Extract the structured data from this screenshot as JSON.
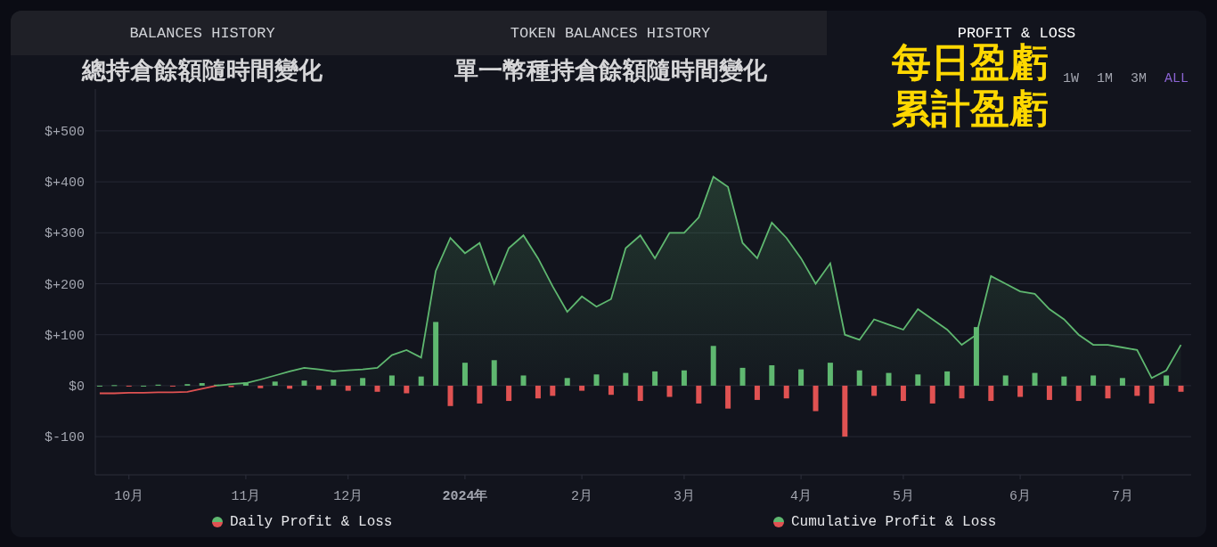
{
  "tabs": [
    {
      "label": "BALANCES HISTORY",
      "annotation": "總持倉餘額隨時間變化",
      "selected": false
    },
    {
      "label": "TOKEN BALANCES HISTORY",
      "annotation": "單一幣種持倉餘額隨時間變化",
      "selected": false
    },
    {
      "label": "PROFIT & LOSS",
      "annotation_lines": [
        "每日盈虧",
        "累計盈虧"
      ],
      "selected": true
    }
  ],
  "ranges": [
    {
      "label": "1W",
      "selected": false
    },
    {
      "label": "1M",
      "selected": false
    },
    {
      "label": "3M",
      "selected": false
    },
    {
      "label": "ALL",
      "selected": true
    }
  ],
  "chart_data": {
    "type": "bar",
    "categories": [
      null,
      null,
      "10月",
      null,
      null,
      null,
      null,
      null,
      null,
      null,
      "11月",
      null,
      null,
      null,
      null,
      null,
      null,
      "12月",
      null,
      null,
      null,
      null,
      null,
      null,
      null,
      "2024年",
      null,
      null,
      null,
      null,
      null,
      null,
      null,
      "2月",
      null,
      null,
      null,
      null,
      null,
      null,
      "3月",
      null,
      null,
      null,
      null,
      null,
      null,
      null,
      "4月",
      null,
      null,
      null,
      null,
      null,
      null,
      "5月",
      null,
      null,
      null,
      null,
      null,
      null,
      null,
      "6月",
      null,
      null,
      null,
      null,
      null,
      null,
      "7月",
      null,
      null,
      null,
      null
    ],
    "series": [
      {
        "color": "#5fb870",
        "values": [
          0,
          1,
          null,
          0,
          2,
          null,
          3,
          5,
          2,
          null,
          6,
          null,
          8,
          null,
          10,
          null,
          12,
          null,
          15,
          null,
          20,
          null,
          18,
          125,
          null,
          45,
          null,
          50,
          null,
          20,
          null,
          null,
          15,
          null,
          22,
          null,
          25,
          null,
          28,
          null,
          30,
          null,
          78,
          null,
          35,
          null,
          40,
          null,
          32,
          null,
          45,
          null,
          30,
          null,
          25,
          null,
          22,
          null,
          28,
          null,
          115,
          null,
          20,
          null,
          25,
          null,
          18,
          null,
          20,
          null,
          15,
          null,
          null,
          20,
          null
        ]
      },
      {
        "color": "#e05252",
        "values": [
          null,
          null,
          -1,
          null,
          null,
          -1,
          null,
          null,
          null,
          -3,
          null,
          -5,
          null,
          -6,
          null,
          -8,
          null,
          -10,
          null,
          -12,
          null,
          -15,
          null,
          null,
          -40,
          null,
          -35,
          null,
          -30,
          null,
          -25,
          -20,
          null,
          -10,
          null,
          -18,
          null,
          -30,
          null,
          -22,
          null,
          -35,
          null,
          -45,
          null,
          -28,
          null,
          -25,
          null,
          -50,
          null,
          -100,
          null,
          -20,
          null,
          -30,
          null,
          -35,
          null,
          -25,
          null,
          -30,
          null,
          -22,
          null,
          -28,
          null,
          -30,
          null,
          -25,
          null,
          -20,
          -35,
          null,
          -12
        ]
      },
      {
        "type": "area",
        "color": "#5fb870",
        "values": [
          null,
          null,
          null,
          null,
          null,
          null,
          null,
          null,
          0,
          3,
          5,
          12,
          20,
          28,
          35,
          32,
          28,
          30,
          32,
          35,
          60,
          70,
          55,
          225,
          290,
          260,
          280,
          200,
          270,
          295,
          250,
          195,
          145,
          175,
          155,
          170,
          270,
          295,
          250,
          300,
          300,
          330,
          410,
          390,
          280,
          250,
          320,
          290,
          250,
          200,
          240,
          100,
          90,
          130,
          120,
          110,
          150,
          130,
          110,
          80,
          100,
          215,
          200,
          185,
          180,
          150,
          130,
          100,
          80,
          80,
          75,
          70,
          15,
          30,
          80
        ]
      },
      {
        "type": "line",
        "color": "#e05252",
        "values": [
          -15,
          -15,
          -14,
          -14,
          -13,
          -13,
          -12,
          -6,
          0,
          null,
          null,
          null,
          null,
          null,
          null,
          null,
          null,
          null,
          null,
          null,
          null,
          null,
          null,
          null,
          null,
          null,
          null,
          null,
          null,
          null,
          null,
          null,
          null,
          null,
          null,
          null,
          null,
          null,
          null,
          null,
          null,
          null,
          null,
          null,
          null,
          null,
          null,
          null,
          null,
          null,
          null,
          null,
          null,
          null,
          null,
          null,
          null,
          null,
          null,
          null,
          null,
          null,
          null,
          null,
          null,
          null,
          null,
          null,
          null,
          null,
          null,
          null,
          null,
          null,
          null
        ]
      }
    ],
    "ylim": [
      -175,
      582
    ],
    "grid": true,
    "yticks": [
      {
        "value": -100,
        "label": "$-100"
      },
      {
        "value": 0,
        "label": "$0"
      },
      {
        "value": 100,
        "label": "$+100"
      },
      {
        "value": 200,
        "label": "$+200"
      },
      {
        "value": 300,
        "label": "$+300"
      },
      {
        "value": 400,
        "label": "$+400"
      },
      {
        "value": 500,
        "label": "$+500"
      }
    ]
  },
  "legend": [
    {
      "label": "Daily Profit & Loss"
    },
    {
      "label": "Cumulative Profit & Loss"
    }
  ]
}
